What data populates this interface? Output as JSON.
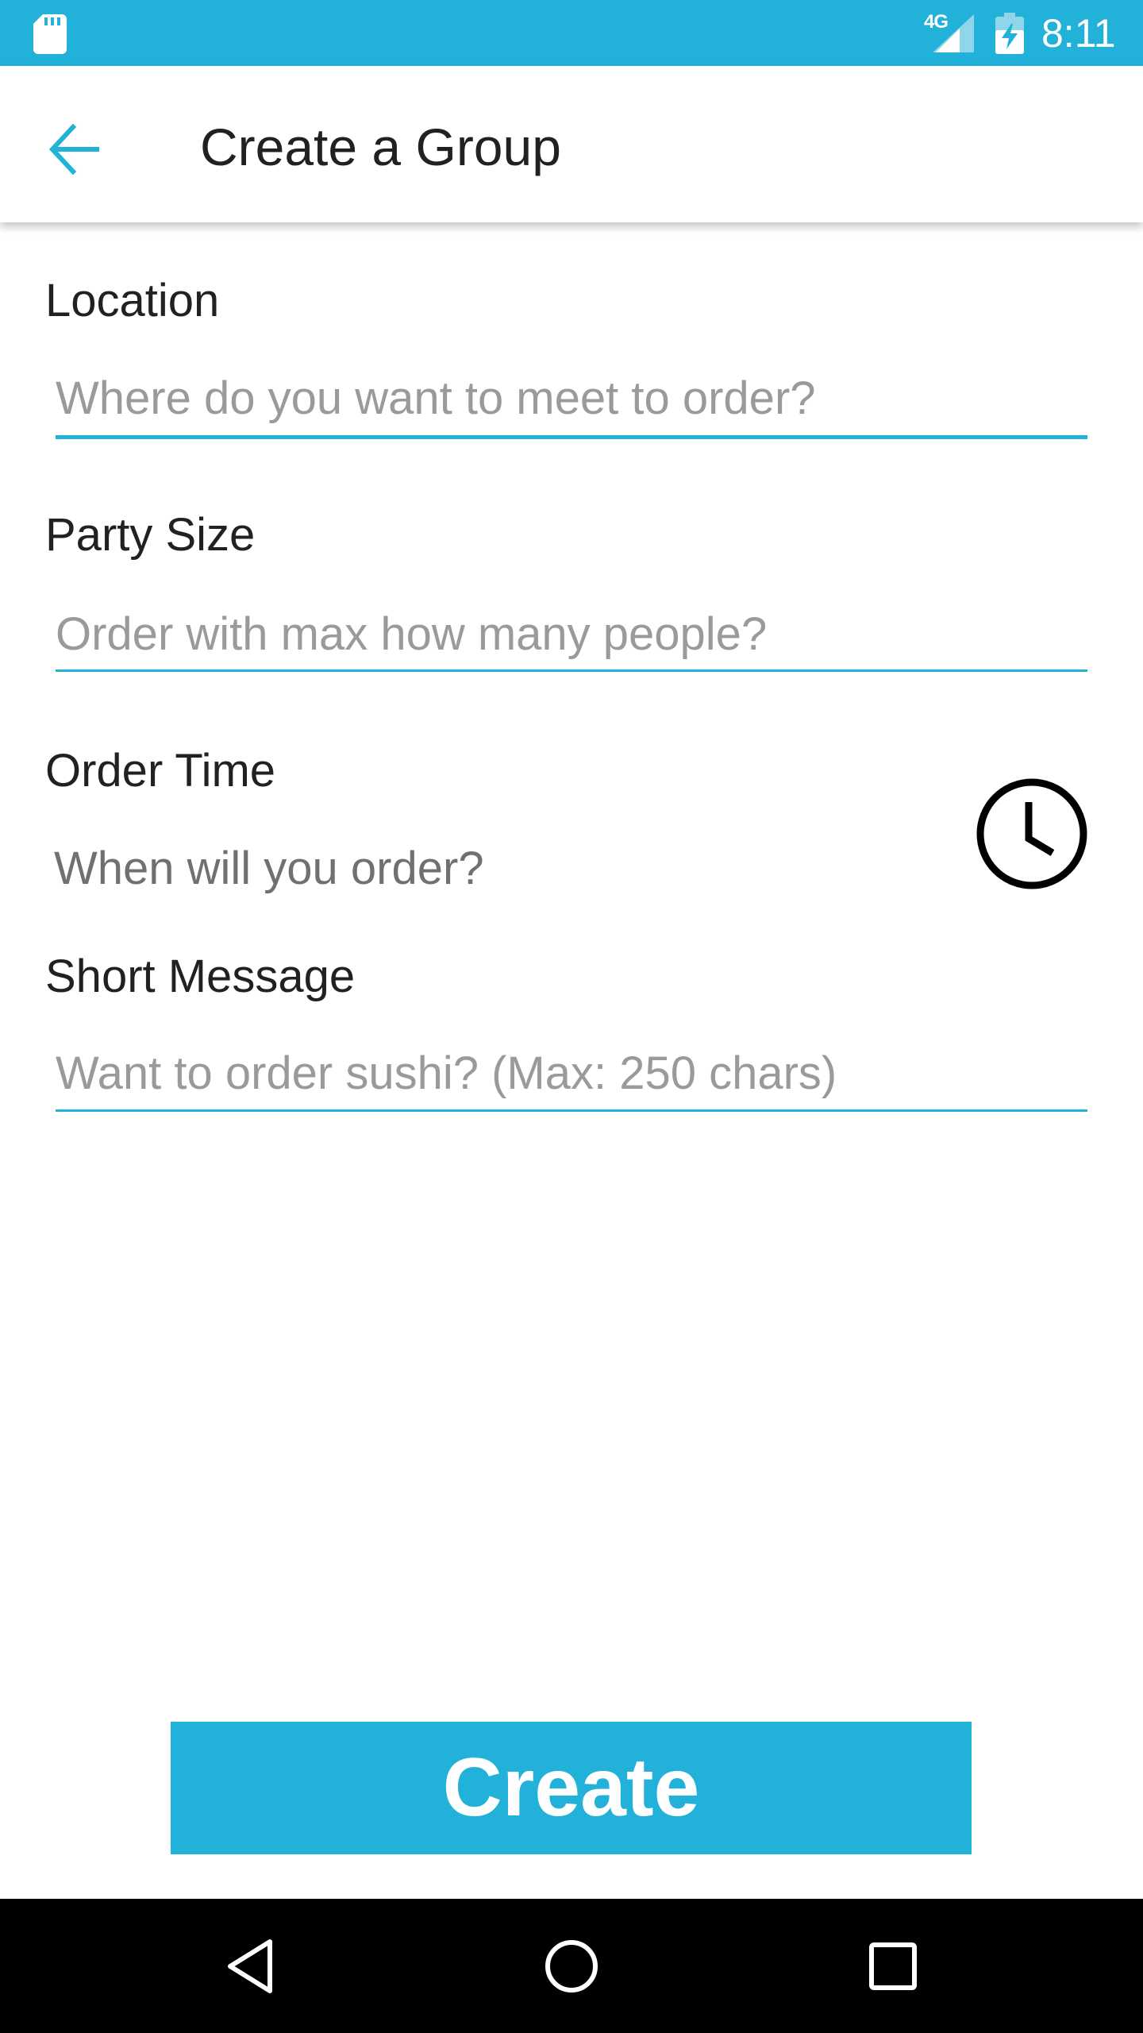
{
  "status_bar": {
    "network_label": "4G",
    "time": "8:11",
    "icons": [
      "sd-card-icon",
      "signal-icon",
      "battery-charging-icon"
    ]
  },
  "app_bar": {
    "title": "Create a Group",
    "back_icon": "arrow-back-icon"
  },
  "form": {
    "location": {
      "label": "Location",
      "placeholder": "Where do you want to meet to order?",
      "value": ""
    },
    "party_size": {
      "label": "Party Size",
      "placeholder": "Order with max how many people?",
      "value": ""
    },
    "order_time": {
      "label": "Order Time",
      "value": "When will you order?",
      "icon": "clock-icon"
    },
    "short_message": {
      "label": "Short Message",
      "placeholder": "Want to order sushi? (Max: 250 chars)",
      "value": ""
    }
  },
  "create_button": {
    "label": "Create"
  },
  "nav_bar": {
    "icons": [
      "back-triangle-icon",
      "home-circle-icon",
      "recents-square-icon"
    ]
  },
  "colors": {
    "accent": "#22b1d9",
    "text": "#212121",
    "placeholder": "#9a9a9a",
    "nav_background": "#000000"
  }
}
